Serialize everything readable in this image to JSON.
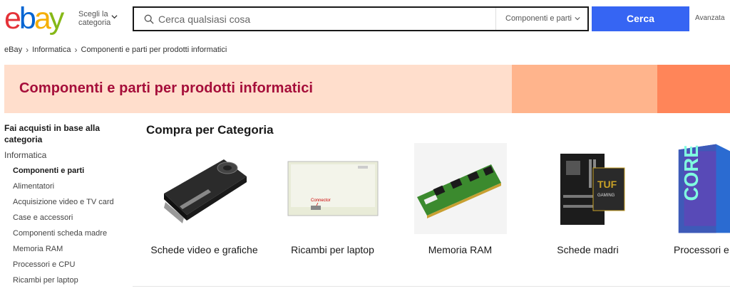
{
  "brand": {
    "logo_letters": [
      "e",
      "b",
      "a",
      "y"
    ],
    "logo_colors": [
      "#e53238",
      "#0064d2",
      "#f5af02",
      "#86b817"
    ]
  },
  "header": {
    "category_picker_label": "Scegli la categoria",
    "search_placeholder": "Cerca qualsiasi cosa",
    "search_category": "Componenti e parti",
    "search_button": "Cerca",
    "advanced_link": "Avanzata",
    "accent_color": "#3665f3"
  },
  "breadcrumb": {
    "items": [
      "eBay",
      "Informatica",
      "Componenti e parti per prodotti informatici"
    ]
  },
  "banner": {
    "title": "Componenti e parti per prodotti informatici",
    "title_color": "#a50e3a"
  },
  "sidebar": {
    "heading": "Fai acquisti in base alla categoria",
    "parent": "Informatica",
    "items": [
      "Componenti e parti",
      "Alimentatori",
      "Acquisizione video e TV card",
      "Case e accessori",
      "Componenti scheda madre",
      "Memoria RAM",
      "Processori e CPU",
      "Ricambi per laptop"
    ],
    "active_index": 0
  },
  "main": {
    "section_title": "Compra per Categoria",
    "categories": [
      {
        "label": "Schede video e grafiche",
        "icon": "graphics-card-image"
      },
      {
        "label": "Ricambi per laptop",
        "icon": "laptop-screen-image"
      },
      {
        "label": "Memoria RAM",
        "icon": "ram-module-image"
      },
      {
        "label": "Schede madri",
        "icon": "motherboard-image"
      },
      {
        "label": "Processori e CPU",
        "icon": "cpu-box-image"
      }
    ],
    "visible_last_label": "Processori e"
  }
}
